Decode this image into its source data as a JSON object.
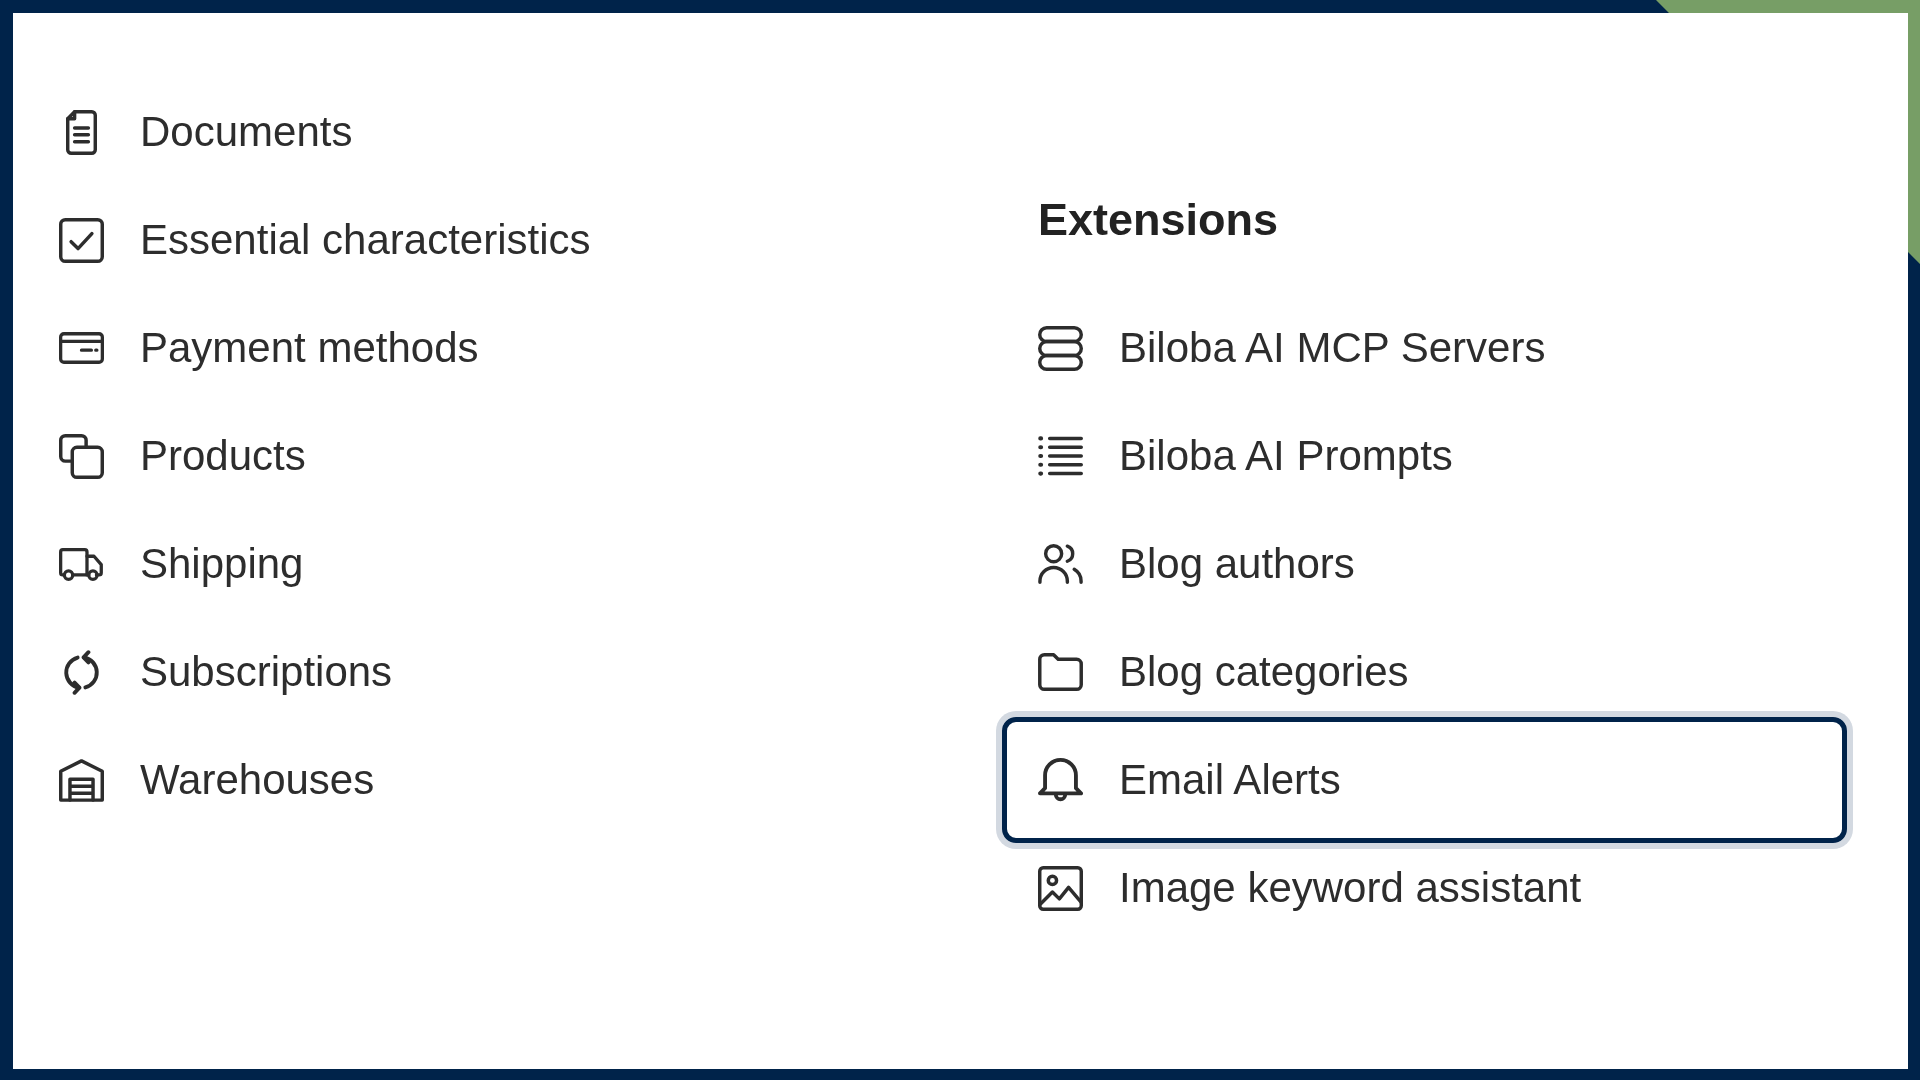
{
  "menu": {
    "items": [
      {
        "label": "Documents"
      },
      {
        "label": "Essential characteristics"
      },
      {
        "label": "Payment methods"
      },
      {
        "label": "Products"
      },
      {
        "label": "Shipping"
      },
      {
        "label": "Subscriptions"
      },
      {
        "label": "Warehouses"
      }
    ]
  },
  "extensions": {
    "title": "Extensions",
    "items": [
      {
        "label": "Biloba AI MCP Servers",
        "focused": false
      },
      {
        "label": "Biloba AI Prompts",
        "focused": false
      },
      {
        "label": "Blog authors",
        "focused": false
      },
      {
        "label": "Blog categories",
        "focused": false
      },
      {
        "label": "Email Alerts",
        "focused": true
      },
      {
        "label": "Image keyword assistant",
        "focused": false
      }
    ]
  }
}
